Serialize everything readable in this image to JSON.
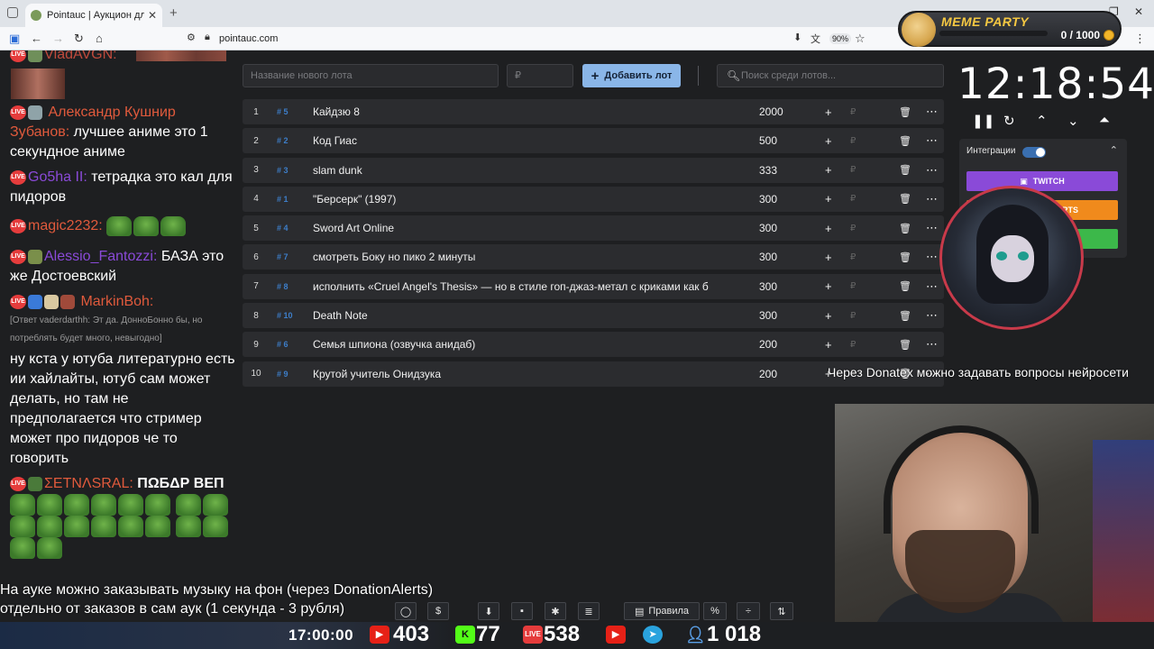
{
  "browser": {
    "tab_title": "Pointauc | Аукцион для стримеров",
    "url": "pointauc.com",
    "zoom": "90%"
  },
  "meme_party": {
    "title": "MEME PARTY",
    "count": "0 / 1000",
    "progress": 0
  },
  "chat": {
    "messages": [
      {
        "user": "VladAVGN:",
        "text": "",
        "color": "#c04a3c"
      },
      {
        "user": "Александр Кушнир Зубанов:",
        "text": "лучшее аниме это 1 секундное аниме",
        "color": "#e05a3c"
      },
      {
        "user": "Go5ha II:",
        "text": "тетрадка это кал для пидоров",
        "color": "#8a4ad8"
      },
      {
        "user": "magic2232:",
        "text": "",
        "color": "#e05a3c"
      },
      {
        "user": "Alessio_Fantozzi:",
        "text": "БАЗА это же Достоевский",
        "color": "#8a4ad8"
      },
      {
        "user": "MarkinBoh:",
        "text": "",
        "color": "#e05a3c"
      },
      {
        "reply": "[Ответ vaderdarthh: Эт да. ДонноБонно бы, но потреблять будет много, невыгодно]"
      },
      {
        "text": "ну кста у ютуба литературно есть ии хайлайты, ютуб сам может делать, но там не предполагается что стример может про пидоров че то говорить"
      },
      {
        "user": "ΣETNΛSRAL:",
        "text": "ΠΩБΔΡ ΒΕΠ",
        "color": "#e05a3c"
      }
    ],
    "live_badge": "LIVE"
  },
  "toolbar": {
    "new_lot_placeholder": "Название нового лота",
    "sum_placeholder": "₽",
    "add_button": "Добавить лот",
    "search_placeholder": "Поиск среди лотов..."
  },
  "lots": [
    {
      "index": "1",
      "fast_id": "# 5",
      "name": "Кайдзю 8",
      "amount": "2000"
    },
    {
      "index": "2",
      "fast_id": "# 2",
      "name": "Код Гиас",
      "amount": "500"
    },
    {
      "index": "3",
      "fast_id": "# 3",
      "name": " slam dunk",
      "amount": "333"
    },
    {
      "index": "4",
      "fast_id": "# 1",
      "name": "\"Берсерк\" (1997)",
      "amount": "300"
    },
    {
      "index": "5",
      "fast_id": "# 4",
      "name": "Sword Art Online",
      "amount": "300"
    },
    {
      "index": "6",
      "fast_id": "# 7",
      "name": "смотреть Боку но пико 2 минуты",
      "amount": "300"
    },
    {
      "index": "7",
      "fast_id": "# 8",
      "name": "исполнить «Cruel Angel's Thesis» — но в стиле гоп-джаз-метал с криками как б",
      "amount": "300"
    },
    {
      "index": "8",
      "fast_id": "# 10",
      "name": "Death Note",
      "amount": "300"
    },
    {
      "index": "9",
      "fast_id": "# 6",
      "name": "Семья шпиона (озвучка анидаб)",
      "amount": "200"
    },
    {
      "index": "10",
      "fast_id": "# 9",
      "name": "Крутой учитель Онидзука",
      "amount": "200"
    }
  ],
  "timer": {
    "value": "12:18:54"
  },
  "integrations": {
    "label": "Интеграции",
    "enabled": true,
    "twitch": "TWITCH",
    "donationalerts": "ERTS",
    "colors": {
      "twitch": "#8a4ad8",
      "da": "#f08a1c",
      "green": "#3cb84a"
    }
  },
  "overlay": {
    "ticker": "Через Donatex можно задавать вопросы нейросети",
    "notice_line1": "На ауке можно заказывать музыку на фон (через DonationAlerts)",
    "notice_line2": "отдельно от заказов в сам аук (1 секунда - 3 рубля)"
  },
  "bottom_toolbar": {
    "rules": "Правила",
    "percent": "%"
  },
  "stream_stats": {
    "clock": "17:00:00",
    "youtube": "403",
    "kick": "77",
    "vk": "538",
    "total": "1 018"
  }
}
